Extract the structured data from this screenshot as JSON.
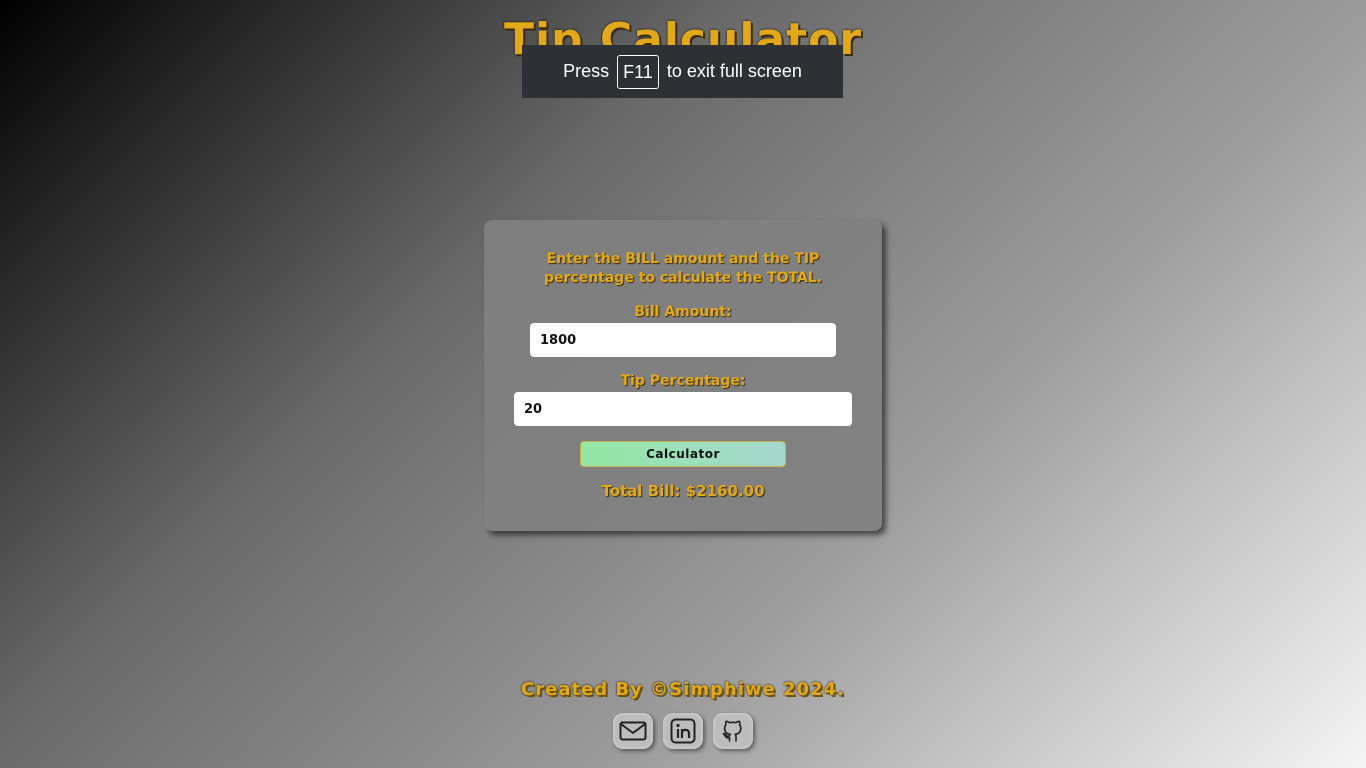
{
  "page": {
    "title": "Tip Calculator"
  },
  "fullscreen_notice": {
    "prefix": "Press",
    "key": "F11",
    "suffix": "to exit full screen"
  },
  "calculator": {
    "instructions": "Enter the BILL amount and the TIP percentage to calculate the TOTAL.",
    "bill_label": "Bill Amount:",
    "bill_value": "1800",
    "tip_label": "Tip Percentage:",
    "tip_value": "20",
    "button_label": "Calculator",
    "total_text": "Total Bill: $2160.00"
  },
  "footer": {
    "credit": "Created By ©Simphiwe 2024.",
    "socials": [
      {
        "icon": "mail-icon"
      },
      {
        "icon": "linkedin-icon"
      },
      {
        "icon": "github-icon"
      }
    ]
  },
  "colors": {
    "accent": "#e2a81c",
    "button_gradient_start": "#93e7a4",
    "button_gradient_end": "#a5d7cf"
  }
}
